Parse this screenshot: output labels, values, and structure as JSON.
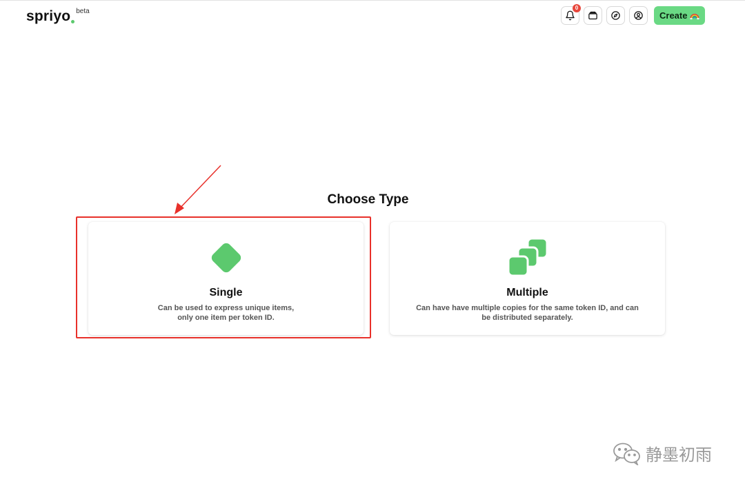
{
  "header": {
    "logo_text": "spriyo",
    "logo_badge": "beta",
    "notification_count": "0",
    "create_label": "Create",
    "icons": [
      "bell-icon",
      "wallet-icon",
      "compass-icon",
      "user-circle-icon",
      "rainbow-emoji-icon"
    ]
  },
  "main": {
    "title": "Choose Type",
    "cards": [
      {
        "title": "Single",
        "desc_line1": "Can be used to express unique items,",
        "desc_line2": "only one item per token ID.",
        "icon": "diamond-icon"
      },
      {
        "title": "Multiple",
        "desc_line1": "Can have have multiple copies for the same token ID, and can",
        "desc_line2": "be distributed separately.",
        "icon": "stacked-squares-icon"
      }
    ]
  },
  "watermark": {
    "text": "静墨初雨"
  },
  "colors": {
    "accent": "#5cc96e",
    "create_button": "#6ad984",
    "badge": "#e8473c",
    "annotation": "#e8302a"
  }
}
